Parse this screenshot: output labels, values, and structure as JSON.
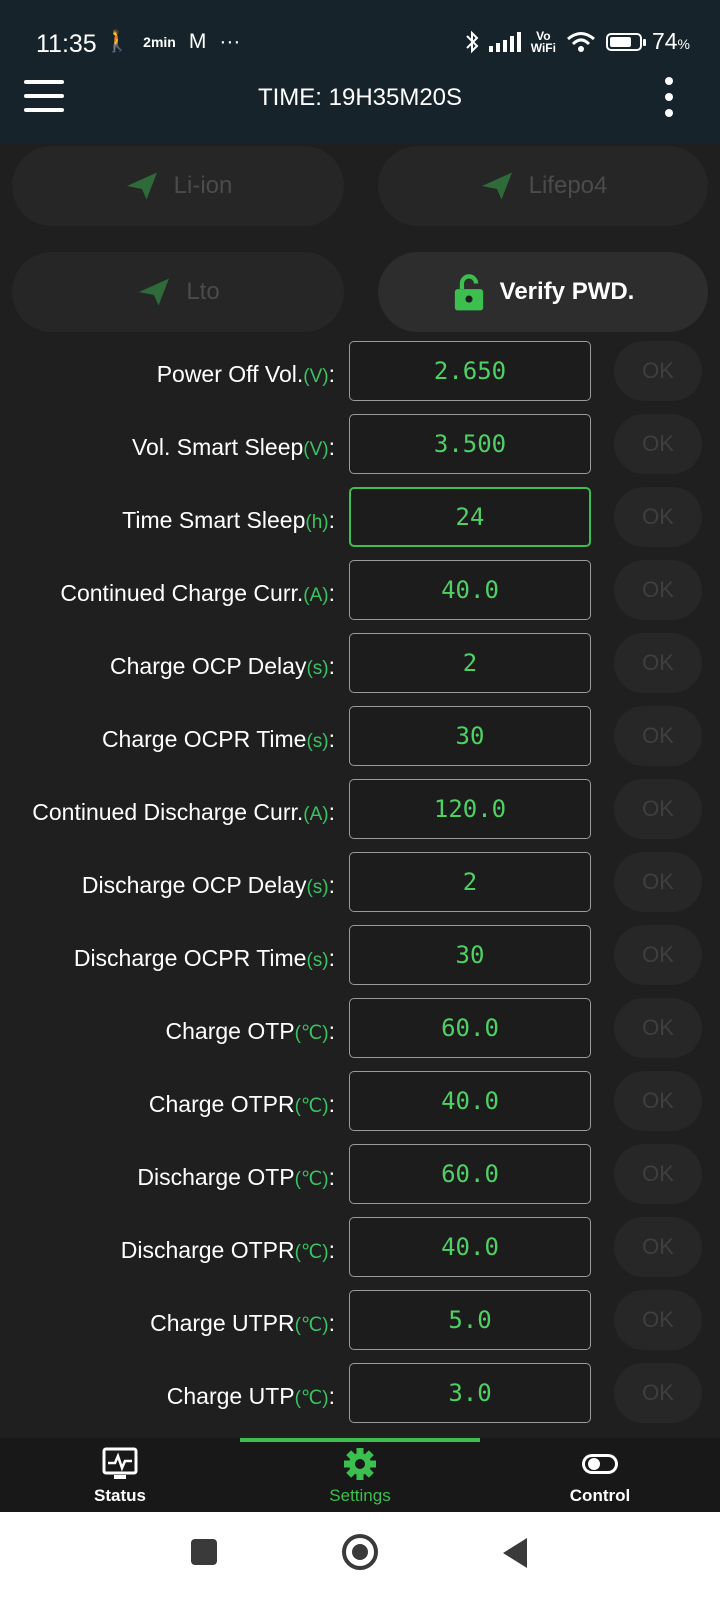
{
  "status_bar": {
    "time": "11:35",
    "left_icons": [
      "walk-icon",
      "2min-icon",
      "gmail-icon",
      "more-icon"
    ],
    "left_icon_glyphs": [
      "🚶",
      "2min",
      "M",
      "···"
    ],
    "battery_percent": "74",
    "battery_suffix": "%",
    "battery_level": 0.74,
    "vowifi_top": "Vo",
    "vowifi_bottom": "WiFi"
  },
  "header": {
    "title": "TIME: 19H35M20S"
  },
  "chemistry_buttons": {
    "li_ion": "Li-ion",
    "lifepo4": "Lifepo4",
    "lto": "Lto",
    "verify_pwd": "Verify PWD."
  },
  "settings": [
    {
      "label": "Power Off Vol.",
      "unit": "(V)",
      "suffix": ":",
      "value": "2.650",
      "ok": "OK"
    },
    {
      "label": "Vol. Smart Sleep",
      "unit": "(V)",
      "suffix": ":",
      "value": "3.500",
      "ok": "OK"
    },
    {
      "label": "Time Smart Sleep",
      "unit": "(h)",
      "suffix": ":",
      "value": "24",
      "ok": "OK"
    },
    {
      "label": "Continued Charge Curr.",
      "unit": "(A)",
      "suffix": ":",
      "value": "40.0",
      "ok": "OK"
    },
    {
      "label": "Charge OCP Delay",
      "unit": "(s)",
      "suffix": ":",
      "value": "2",
      "ok": "OK"
    },
    {
      "label": "Charge OCPR Time",
      "unit": "(s)",
      "suffix": ":",
      "value": "30",
      "ok": "OK"
    },
    {
      "label": "Continued Discharge Curr.",
      "unit": "(A)",
      "suffix": ":",
      "value": "120.0",
      "ok": "OK"
    },
    {
      "label": "Discharge OCP Delay",
      "unit": "(s)",
      "suffix": ":",
      "value": "2",
      "ok": "OK"
    },
    {
      "label": "Discharge OCPR Time",
      "unit": "(s)",
      "suffix": ":",
      "value": "30",
      "ok": "OK"
    },
    {
      "label": "Charge OTP",
      "unit": "(℃)",
      "suffix": ":",
      "value": "60.0",
      "ok": "OK"
    },
    {
      "label": "Charge OTPR",
      "unit": "(℃)",
      "suffix": ":",
      "value": "40.0",
      "ok": "OK"
    },
    {
      "label": "Discharge OTP",
      "unit": "(℃)",
      "suffix": ":",
      "value": "60.0",
      "ok": "OK"
    },
    {
      "label": "Discharge OTPR",
      "unit": "(℃)",
      "suffix": ":",
      "value": "40.0",
      "ok": "OK"
    },
    {
      "label": "Charge UTPR",
      "unit": "(℃)",
      "suffix": ":",
      "value": "5.0",
      "ok": "OK"
    },
    {
      "label": "Charge UTP",
      "unit": "(℃)",
      "suffix": ":",
      "value": "3.0",
      "ok": "OK"
    }
  ],
  "bottom_nav": {
    "status": "Status",
    "settings": "Settings",
    "control": "Control"
  },
  "colors": {
    "accent_green": "#3cbf4e",
    "header_bg": "#16232b",
    "page_bg": "#1f1f1f"
  }
}
